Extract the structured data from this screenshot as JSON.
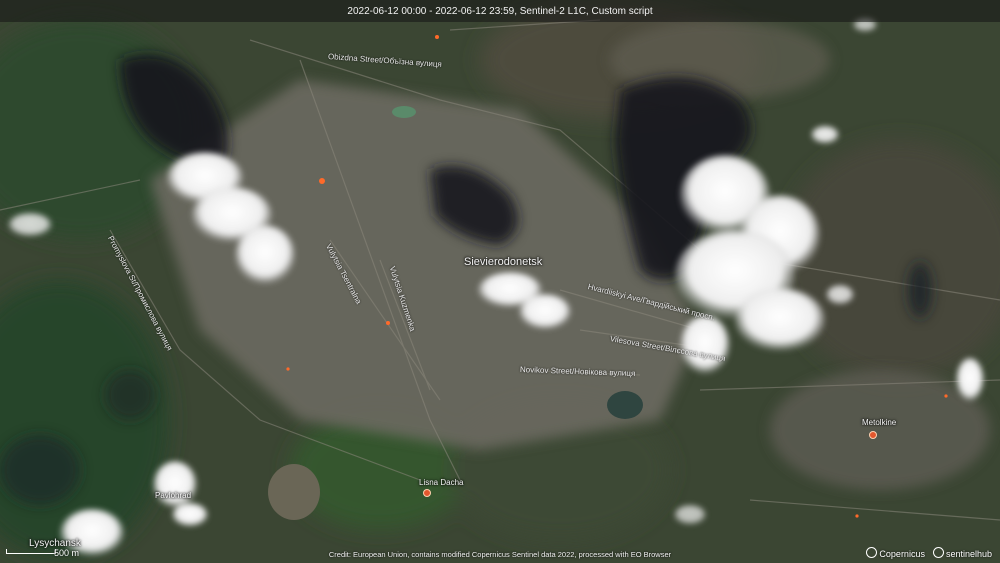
{
  "header": {
    "title": "2022-06-12 00:00 - 2022-06-12 23:59, Sentinel-2 L1C, Custom script"
  },
  "places": {
    "main_city": "Sievierodonetsk",
    "lysychansk": "Lysychansk",
    "pavlohrad": "Pavlohrad",
    "lisna_dacha": "Lisna Dacha",
    "metolkine": "Metolkine"
  },
  "streets": {
    "street_1": "Obizdna Street/Объїзна вулиця",
    "street_2": "Promyslova St/Промислова вулиця",
    "street_3": "Vulytsia Tsentralna",
    "street_4": "Hvardiiskyi Ave/Гвардійський просп.",
    "street_5": "Vilesova Street/Вілєсова вулиця",
    "street_6": "Novikov Street/Новікова вулиця",
    "street_7": "Vulytsia Kuzmenka"
  },
  "scale": {
    "label": "500 m"
  },
  "credit": "Credit: European Union, contains modified Copernicus Sentinel data 2022, processed with EO Browser",
  "logos": {
    "copernicus": "Copernicus",
    "sentinelhub": "sentinelhub"
  },
  "colors": {
    "vegetation": "#34452f",
    "urban": "#6b6a60",
    "smoke": "#1a1c22",
    "cloud": "#f6f6f6",
    "fire": "#ff6a2a"
  }
}
